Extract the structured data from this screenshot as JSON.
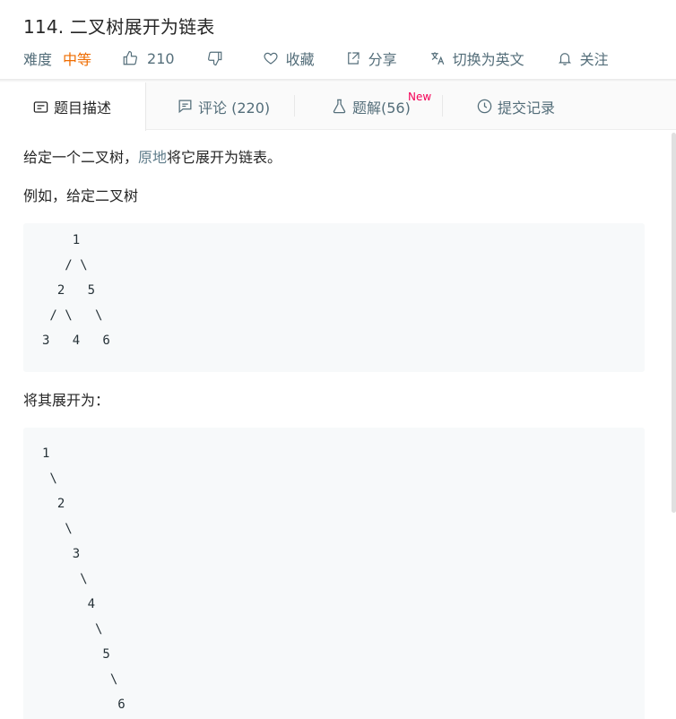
{
  "problem": {
    "title": "114. 二叉树展开为链表",
    "difficulty_label": "难度",
    "difficulty_value": "中等",
    "likes": "210",
    "favorite_label": "收藏",
    "share_label": "分享",
    "switch_lang_label": "切换为英文",
    "follow_label": "关注"
  },
  "tabs": [
    {
      "label": "题目描述",
      "icon": "description-icon",
      "active": true
    },
    {
      "label": "评论 (220)",
      "icon": "comment-icon",
      "active": false
    },
    {
      "label": "题解(56)",
      "icon": "flask-icon",
      "active": false,
      "badge": "New"
    },
    {
      "label": "提交记录",
      "icon": "clock-icon",
      "active": false
    }
  ],
  "description": {
    "intro_before": "给定一个二叉树，",
    "intro_link": "原地",
    "intro_after": "将它展开为链表。",
    "example_label": "例如，给定二叉树",
    "tree_example": "    1\n   / \\\n  2   5\n / \\   \\\n3   4   6",
    "result_label": "将其展开为：",
    "list_result": "1\n \\\n  2\n   \\\n    3\n     \\\n      4\n       \\\n        5\n         \\\n          6"
  },
  "colors": {
    "accent_medium": "#ef6c00",
    "new_badge": "#f50057",
    "link": "#607d8b",
    "meta_text": "#546e7a"
  }
}
